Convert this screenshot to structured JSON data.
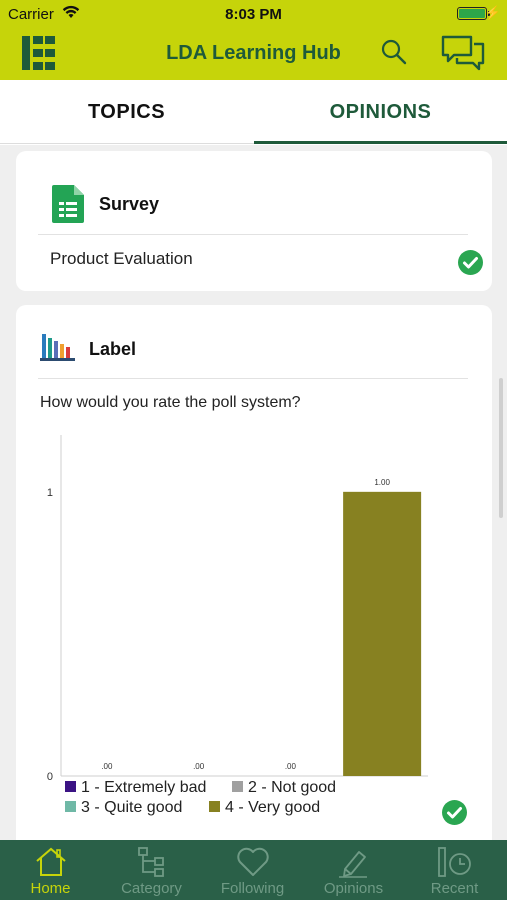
{
  "status_bar": {
    "carrier": "Carrier",
    "time": "8:03 PM",
    "wifi_icon": "wifi-icon",
    "battery_icon": "battery-charging-icon"
  },
  "nav": {
    "title": "LDA Learning Hub",
    "menu_icon": "grid-list-icon",
    "search_icon": "search-icon",
    "chat_icon": "chat-bubbles-icon"
  },
  "tabs": [
    {
      "label": "TOPICS",
      "active": false
    },
    {
      "label": "OPINIONS",
      "active": true
    }
  ],
  "survey_card": {
    "icon": "spreadsheet-icon",
    "title": "Survey",
    "item": "Product Evaluation",
    "completed": true
  },
  "poll_card": {
    "icon": "bar-chart-icon",
    "title": "Label",
    "question": "How would you rate the poll system?",
    "completed": true
  },
  "chart_data": {
    "type": "bar",
    "categories": [
      "1 - Extremely bad",
      "2 - Not good",
      "3 - Quite good",
      "4 - Very good"
    ],
    "values": [
      0,
      0,
      0,
      1
    ],
    "value_labels": [
      ".00",
      ".00",
      ".00",
      "1.00"
    ],
    "y_ticks": [
      "0",
      "1"
    ],
    "ylim": [
      0,
      1.2
    ],
    "colors": [
      "#3b1384",
      "#a0a0a0",
      "#6fb8a6",
      "#878121"
    ],
    "legend": "bottom",
    "grid": false
  },
  "bottom_tabs": [
    {
      "label": "Home",
      "icon": "home-icon",
      "active": true
    },
    {
      "label": "Category",
      "icon": "hierarchy-icon",
      "active": false
    },
    {
      "label": "Following",
      "icon": "heart-icon",
      "active": false
    },
    {
      "label": "Opinions",
      "icon": "pen-icon",
      "active": false
    },
    {
      "label": "Recent",
      "icon": "recent-clock-icon",
      "active": false
    }
  ],
  "colors": {
    "brand_lime": "#c6d40a",
    "brand_green": "#1e5a3a",
    "tabbar_green": "#2a6048",
    "check_green": "#2aa651"
  }
}
